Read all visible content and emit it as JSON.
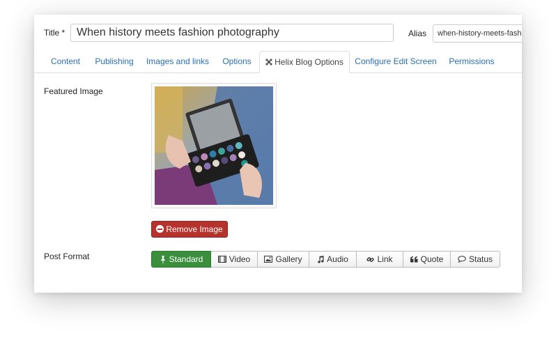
{
  "title_field": {
    "label": "Title *",
    "value": "When history meets fashion photography"
  },
  "alias_field": {
    "label": "Alias",
    "value": "when-history-meets-fashion-photography"
  },
  "tabs": [
    {
      "label": "Content"
    },
    {
      "label": "Publishing"
    },
    {
      "label": "Images and links"
    },
    {
      "label": "Options"
    },
    {
      "label": "Helix Blog Options",
      "active": true,
      "icon": "joomla-icon"
    },
    {
      "label": "Configure Edit Screen"
    },
    {
      "label": "Permissions"
    }
  ],
  "featured_image": {
    "label": "Featured Image",
    "remove_label": "Remove Image"
  },
  "post_format": {
    "label": "Post Format",
    "options": [
      {
        "label": "Standard",
        "icon": "pushpin-icon",
        "active": true
      },
      {
        "label": "Video",
        "icon": "film-icon"
      },
      {
        "label": "Gallery",
        "icon": "image-icon"
      },
      {
        "label": "Audio",
        "icon": "music-note-icon"
      },
      {
        "label": "Link",
        "icon": "link-icon"
      },
      {
        "label": "Quote",
        "icon": "quote-icon"
      },
      {
        "label": "Status",
        "icon": "speech-bubble-icon"
      }
    ]
  },
  "colors": {
    "link": "#2a6eb5",
    "danger": "#b5332c",
    "success": "#3b8e3c"
  }
}
